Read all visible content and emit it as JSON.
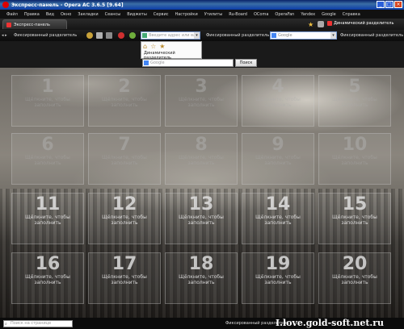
{
  "window": {
    "title": "Экспресс-панель - Opera AC 3.6.5 [9.64]",
    "controls": [
      "_",
      "□",
      "×"
    ]
  },
  "menu": [
    "Файл",
    "Правка",
    "Вид",
    "Окно",
    "Закладки",
    "Сеансы",
    "Виджеты",
    "Сервис",
    "Настройки",
    "Утилиты",
    "Ru-Board",
    "OComa",
    "OperaFan",
    "Yandex",
    "Google",
    "Справка"
  ],
  "tabs": [
    {
      "label": "Экспресс-панель"
    }
  ],
  "tabbar_right": {
    "label": "Динамический разделитель"
  },
  "toolbar": {
    "left_label": "Фиксированный разделитель",
    "address_placeholder": "Введите адрес или ва",
    "mid_label": "Фиксированный разделитель",
    "search_engine": "Google",
    "right_label": "Фиксированный разделитель"
  },
  "dropdown": {
    "item": "Динамический разделитель"
  },
  "search": {
    "placeholder": "Google",
    "button": "Поиск"
  },
  "speed_dial": {
    "hint": "Щёлкните, чтобы заполнить",
    "cells": [
      "1",
      "2",
      "3",
      "4",
      "5",
      "6",
      "7",
      "8",
      "9",
      "10",
      "11",
      "12",
      "13",
      "14",
      "15",
      "16",
      "17",
      "18",
      "19",
      "20"
    ]
  },
  "status": {
    "find_placeholder": "Поиск на странице",
    "mid_label": "Фиксированный разделитель"
  },
  "watermark": "I.love.gold-soft.net.ru",
  "colors": {
    "titlebar": "#0b3ca8",
    "accent_red": "#dd3333"
  }
}
